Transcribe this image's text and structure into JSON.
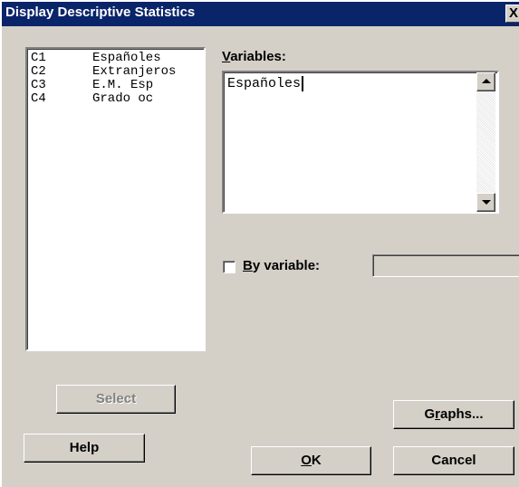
{
  "window": {
    "title": "Display Descriptive Statistics",
    "close_glyph": "X"
  },
  "variable_list": {
    "items": [
      {
        "column": "C1",
        "name": "Españoles"
      },
      {
        "column": "C2",
        "name": "Extranjeros"
      },
      {
        "column": "C3",
        "name": "E.M. Esp"
      },
      {
        "column": "C4",
        "name": "Grado oc"
      }
    ]
  },
  "variables": {
    "label_accel": "V",
    "label_rest": "ariables:",
    "value": "Españoles"
  },
  "by_variable": {
    "checked": false,
    "label_accel": "B",
    "label_rest": "y variable:",
    "value": ""
  },
  "buttons": {
    "select": "Select",
    "help": "Help",
    "graphs_pre": "G",
    "graphs_accel": "r",
    "graphs_post": "aphs...",
    "ok_accel": "O",
    "ok_rest": "K",
    "cancel": "Cancel"
  },
  "colors": {
    "titlebar": "#0a246a",
    "face": "#d4d0c8"
  }
}
